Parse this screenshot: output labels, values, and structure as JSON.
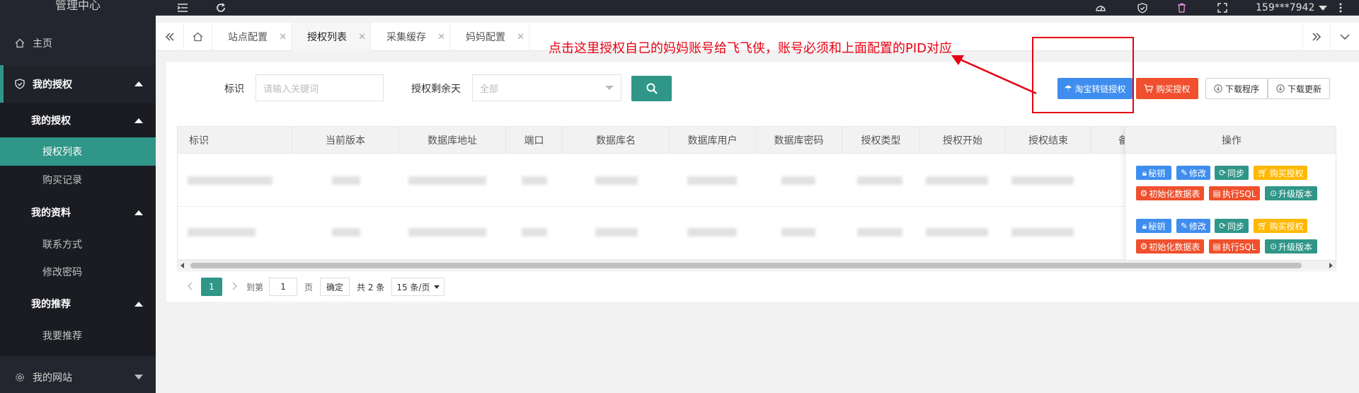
{
  "app": {
    "title": "管理中心"
  },
  "sidebar": {
    "items": [
      {
        "label": "主页"
      },
      {
        "label": "我的授权"
      },
      {
        "label": "我的授权"
      },
      {
        "label": "授权列表"
      },
      {
        "label": "购买记录"
      },
      {
        "label": "我的资料"
      },
      {
        "label": "联系方式"
      },
      {
        "label": "修改密码"
      },
      {
        "label": "我的推荐"
      },
      {
        "label": "我要推荐"
      },
      {
        "label": "我的网站"
      }
    ]
  },
  "topbar": {
    "user": "159***7942"
  },
  "tabs": [
    {
      "label": "站点配置"
    },
    {
      "label": "授权列表"
    },
    {
      "label": "采集缓存"
    },
    {
      "label": "妈妈配置"
    }
  ],
  "filters": {
    "id_label": "标识",
    "id_placeholder": "请输入关键词",
    "days_label": "授权剩余天",
    "days_value": "全部"
  },
  "actions": {
    "taobao": "淘宝转链授权",
    "buy": "购买授权",
    "download": "下载程序",
    "update": "下载更新"
  },
  "annotation": "点击这里授权自己的妈妈账号给飞飞侠，账号必须和上面配置的PID对应",
  "table": {
    "headers": [
      "标识",
      "当前版本",
      "数据库地址",
      "端口",
      "数据库名",
      "数据库用户",
      "数据库密码",
      "授权类型",
      "授权开始",
      "授权结束",
      "备注",
      "操作"
    ],
    "ops": [
      "秘钥",
      "修改",
      "同步",
      "购买授权",
      "初始化数据表",
      "执行SQL",
      "升级版本"
    ]
  },
  "pager": {
    "current": "1",
    "goto_label": "到第",
    "goto_value": "1",
    "page_unit": "页",
    "confirm": "确定",
    "total": "共 2 条",
    "page_size": "15 条/页"
  },
  "colors": {
    "accent": "#2f9688",
    "sidebar": "#23262e",
    "danger": "#f0502d",
    "primary": "#3f8eef",
    "warning": "#ffb800",
    "annotation": "#e60012"
  }
}
